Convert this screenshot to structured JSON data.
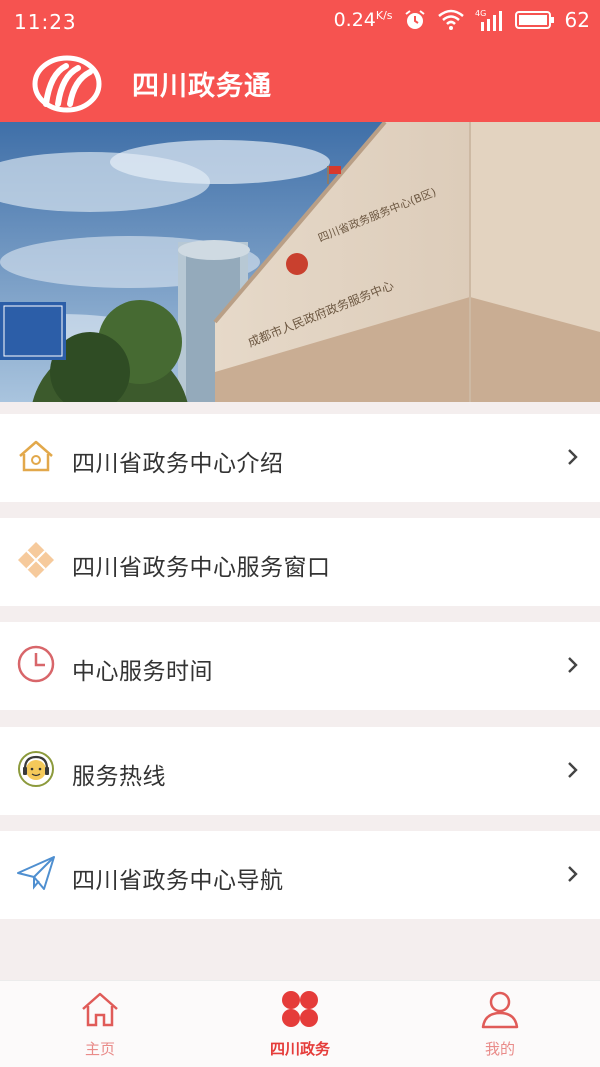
{
  "status_bar": {
    "time": "11:23",
    "speed": "0.24",
    "speed_unit": "K/s",
    "network": "4G",
    "battery": "62",
    "icons": [
      "alarm-icon",
      "wifi-icon",
      "signal-icon",
      "battery-icon"
    ]
  },
  "app": {
    "title": "四川政务通",
    "brand_color": "#f65350"
  },
  "banner": {
    "sign_line1": "四川省政务服务中心(B区)",
    "sign_line2": "成都市人民政府政务服务中心"
  },
  "menu": [
    {
      "label": "四川省政务中心介绍",
      "icon": "house-icon",
      "has_chevron": true
    },
    {
      "label": "四川省政务中心服务窗口",
      "icon": "diamond-icon",
      "has_chevron": false
    },
    {
      "label": "中心服务时间",
      "icon": "clock-icon",
      "has_chevron": true
    },
    {
      "label": "服务热线",
      "icon": "headset-icon",
      "has_chevron": true
    },
    {
      "label": "四川省政务中心导航",
      "icon": "paper-plane-icon",
      "has_chevron": true
    }
  ],
  "tabs": [
    {
      "label": "主页",
      "icon": "home-icon",
      "active": false
    },
    {
      "label": "四川政务",
      "icon": "clover-icon",
      "active": true
    },
    {
      "label": "我的",
      "icon": "user-icon",
      "active": false
    }
  ]
}
